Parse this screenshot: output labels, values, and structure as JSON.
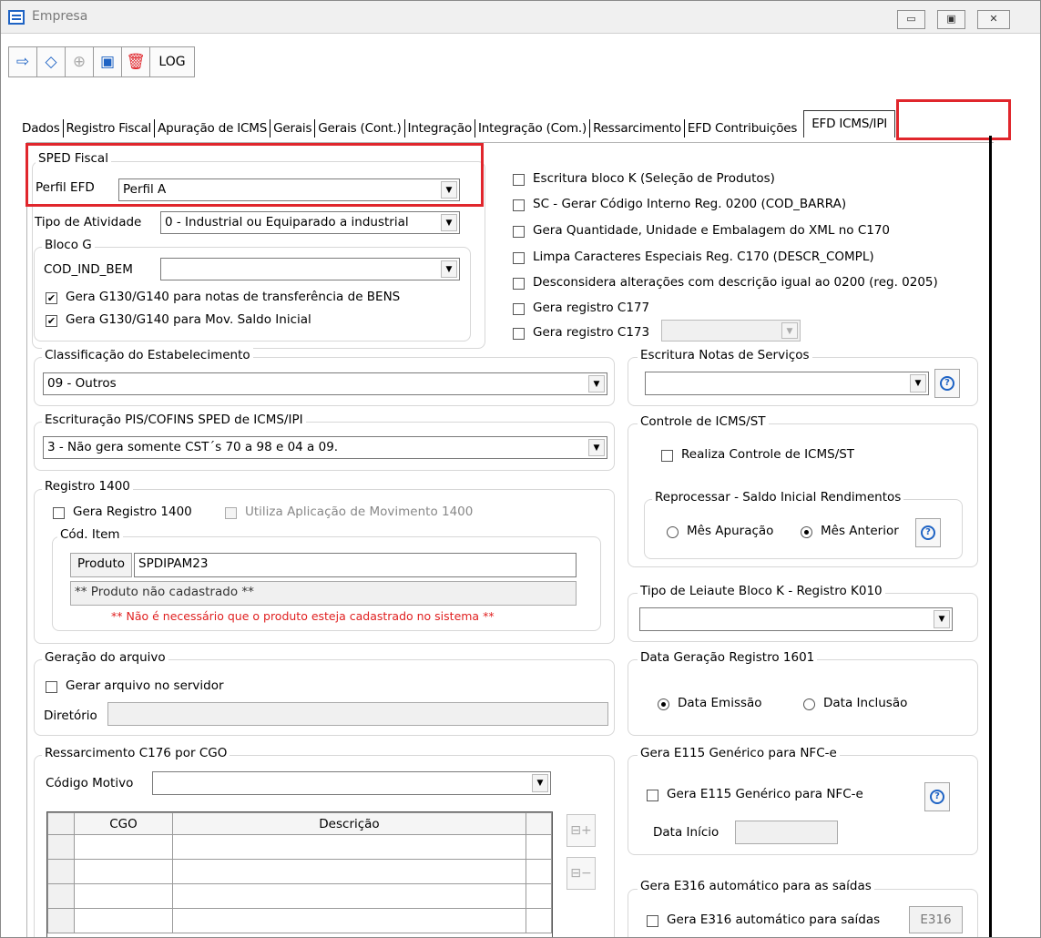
{
  "window": {
    "title": "Empresa",
    "min": "▭",
    "max": "▣",
    "close": "✕"
  },
  "toolbar": {
    "log_label": "LOG",
    "icons": [
      "exit-icon",
      "eraser-icon",
      "add-icon",
      "save-icon",
      "delete-icon"
    ]
  },
  "tabs": [
    {
      "label": "Dados"
    },
    {
      "label": "Registro Fiscal"
    },
    {
      "label": "Apuração de ICMS"
    },
    {
      "label": "Gerais"
    },
    {
      "label": "Gerais (Cont.)"
    },
    {
      "label": "Integração"
    },
    {
      "label": "Integração (Com.)"
    },
    {
      "label": "Ressarcimento"
    },
    {
      "label": "EFD Contribuições"
    },
    {
      "label": "EFD ICMS/IPI"
    }
  ],
  "sped": {
    "group": "SPED Fiscal",
    "perfil_label": "Perfil EFD",
    "perfil_value": "Perfil A",
    "tipo_label": "Tipo de Atividade",
    "tipo_value": "0 - Industrial ou Equiparado a industrial"
  },
  "bloco_g": {
    "group": "Bloco G",
    "cod_label": "COD_IND_BEM",
    "cod_value": "",
    "check1": "Gera G130/G140 para notas de transferência de BENS",
    "check2": "Gera G130/G140 para Mov. Saldo Inicial"
  },
  "right_checks": [
    {
      "label": "Escritura bloco K (Seleção de Produtos)"
    },
    {
      "label": "SC - Gerar Código Interno Reg. 0200 (COD_BARRA)"
    },
    {
      "label": "Gera Quantidade, Unidade e Embalagem do XML no C170"
    },
    {
      "label": "Limpa Caracteres Especiais Reg. C170 (DESCR_COMPL)"
    },
    {
      "label": "Desconsidera alterações com descrição igual ao 0200 (reg. 0205)"
    },
    {
      "label": "Gera registro C177"
    },
    {
      "label": "Gera registro C173"
    }
  ],
  "classificacao": {
    "group": "Classificação do Estabelecimento",
    "value": "09 - Outros"
  },
  "escrit_pis": {
    "group": "Escrituração PIS/COFINS SPED de ICMS/IPI",
    "value": "3 - Não gera somente CST´s 70 a 98 e 04 a 09."
  },
  "registro1400": {
    "group": "Registro 1400",
    "check1": "Gera Registro 1400",
    "check2": "Utiliza Aplicação de Movimento 1400",
    "cod_item_group": "Cód. Item",
    "produto_btn": "Produto",
    "produto_value": "SPDIPAM23",
    "produto_status": "** Produto não cadastrado **",
    "warning": "** Não é necessário que o produto esteja cadastrado no sistema **"
  },
  "geracao": {
    "group": "Geração do arquivo",
    "check": "Gerar arquivo no servidor",
    "dir_label": "Diretório",
    "dir_value": ""
  },
  "ressarc": {
    "group": "Ressarcimento C176 por CGO",
    "motivo_label": "Código Motivo",
    "motivo_value": "",
    "columns": [
      "CGO",
      "Descrição"
    ],
    "add_btn": "⊟+",
    "remove_btn": "⊟−"
  },
  "notas_servico": {
    "group": "Escritura Notas de Serviços",
    "value": ""
  },
  "icms_st": {
    "group": "Controle de ICMS/ST",
    "check": "Realiza Controle de ICMS/ST",
    "reproc_group": "Reprocessar - Saldo Inicial Rendimentos",
    "radio1": "Mês Apuração",
    "radio2": "Mês Anterior"
  },
  "leiaute_k": {
    "group": "Tipo de Leiaute Bloco K - Registro K010",
    "value": ""
  },
  "data1601": {
    "group": "Data Geração Registro 1601",
    "radio1": "Data Emissão",
    "radio2": "Data Inclusão"
  },
  "e115": {
    "group": "Gera E115 Genérico para NFC-e",
    "check": "Gera E115 Genérico para NFC-e",
    "data_label": "Data Início",
    "data_value": ""
  },
  "e316": {
    "group": "Gera E316 automático para as saídas",
    "check": "Gera E316 automático para saídas",
    "btn": "E316"
  },
  "colors": {
    "highlight": "#e0262c",
    "warning": "#e02020",
    "help": "#1e63c4"
  }
}
